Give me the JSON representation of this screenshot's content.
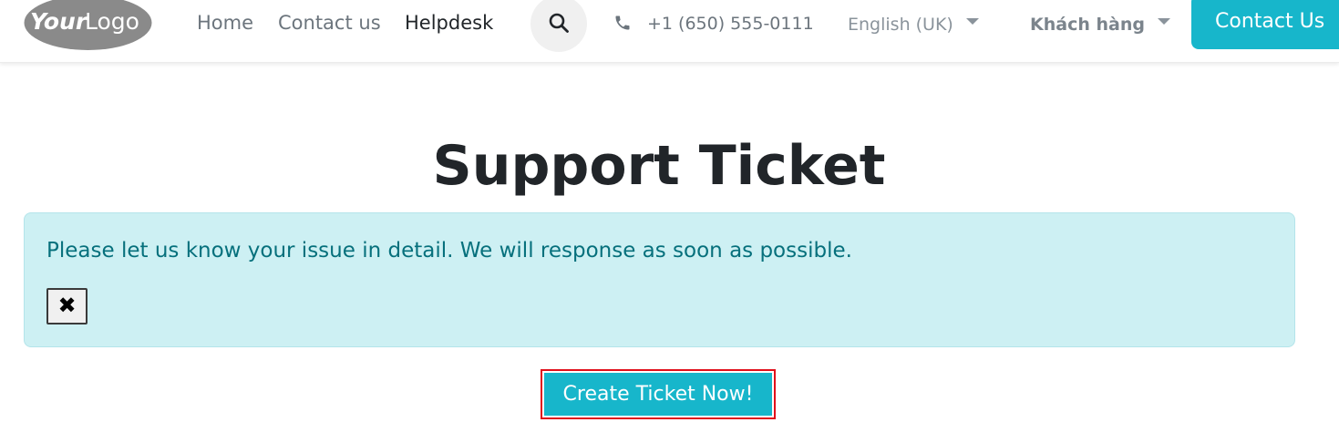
{
  "header": {
    "logo_text": "YourLogo",
    "nav": {
      "home": "Home",
      "contact": "Contact us",
      "helpdesk": "Helpdesk"
    },
    "phone": "+1 (650) 555-0111",
    "language": "English (UK)",
    "user": "Khách hàng",
    "cta_label": "Contact Us"
  },
  "main": {
    "title": "Support Ticket",
    "alert_message": "Please let us know your issue in detail. We will response as soon as possible.",
    "close_symbol": "✖",
    "create_button": "Create Ticket Now!"
  },
  "colors": {
    "accent": "#17b6cb",
    "alert_background": "#cdf0f3",
    "alert_text": "#06707c",
    "highlight_border": "#e0101b"
  },
  "icons": [
    "logo-icon",
    "search-icon",
    "phone-icon",
    "chevron-down-icon",
    "close-icon"
  ]
}
